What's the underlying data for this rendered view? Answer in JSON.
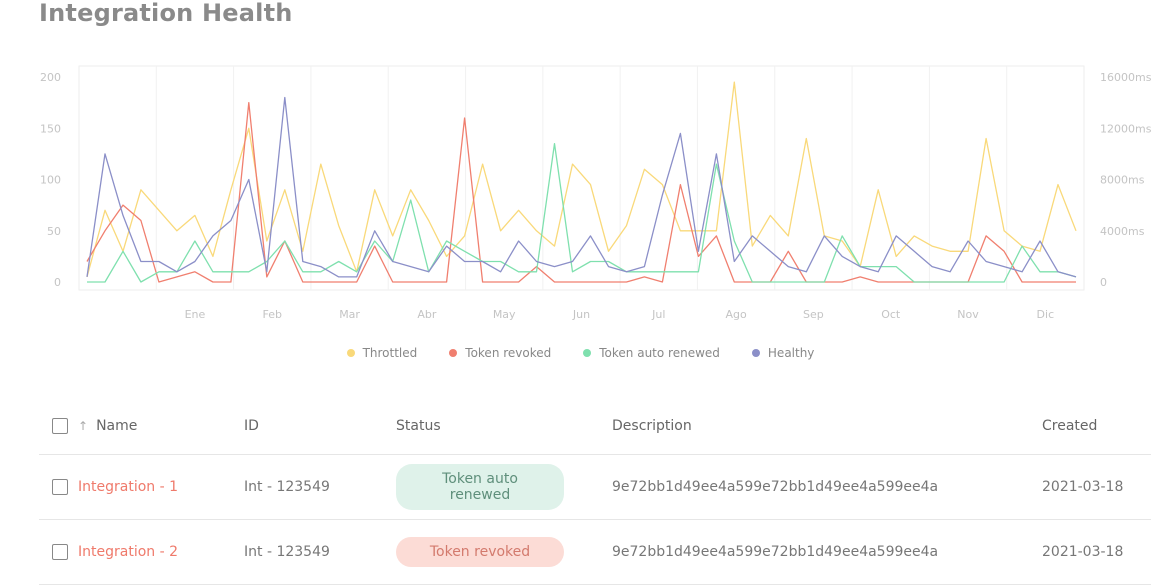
{
  "title": "Integration Health",
  "chart_data": {
    "type": "line",
    "categories": [
      "",
      "Ene",
      "Feb",
      "Mar",
      "Abr",
      "May",
      "Jun",
      "Jul",
      "Ago",
      "Sep",
      "Oct",
      "Nov",
      "Dic"
    ],
    "ylim_left": [
      0,
      200
    ],
    "yticks_left": [
      "0",
      "50",
      "100",
      "150",
      "200"
    ],
    "ylim_right": [
      0,
      16000
    ],
    "yticks_right": [
      "0",
      "4000ms",
      "8000ms",
      "12000ms",
      "16000ms"
    ],
    "grid": true,
    "legend_position": "bottom",
    "series": [
      {
        "name": "Throttled",
        "color": "#f9d97a",
        "values": [
          5,
          70,
          30,
          90,
          70,
          50,
          65,
          25,
          90,
          150,
          40,
          90,
          30,
          115,
          55,
          10,
          90,
          45,
          90,
          60,
          25,
          45,
          115,
          50,
          70,
          50,
          35,
          115,
          95,
          30,
          55,
          110,
          95,
          50,
          50,
          50,
          195,
          35,
          65,
          45,
          140,
          45,
          40,
          15,
          90,
          25,
          45,
          35,
          30,
          30,
          140,
          50,
          35,
          30,
          95,
          50
        ]
      },
      {
        "name": "Token revoked",
        "color": "#f07f6f",
        "values": [
          20,
          50,
          75,
          60,
          0,
          5,
          10,
          0,
          0,
          175,
          5,
          40,
          0,
          0,
          0,
          0,
          35,
          0,
          0,
          0,
          0,
          160,
          0,
          0,
          0,
          15,
          0,
          0,
          0,
          0,
          0,
          5,
          0,
          95,
          25,
          45,
          0,
          0,
          0,
          30,
          0,
          0,
          0,
          5,
          0,
          0,
          0,
          0,
          0,
          0,
          45,
          30,
          0,
          0,
          0,
          0
        ]
      },
      {
        "name": "Token auto renewed",
        "color": "#7fe0ae",
        "values": [
          0,
          0,
          30,
          0,
          10,
          10,
          40,
          10,
          10,
          10,
          20,
          40,
          10,
          10,
          20,
          10,
          40,
          20,
          80,
          10,
          40,
          30,
          20,
          20,
          10,
          10,
          135,
          10,
          20,
          20,
          10,
          10,
          10,
          10,
          10,
          115,
          40,
          0,
          0,
          0,
          0,
          0,
          45,
          15,
          15,
          15,
          0,
          0,
          0,
          0,
          0,
          0,
          35,
          10,
          10,
          5
        ]
      },
      {
        "name": "Healthy",
        "color": "#8b8fc8",
        "values": [
          5,
          125,
          65,
          20,
          20,
          10,
          20,
          45,
          60,
          100,
          10,
          180,
          20,
          15,
          5,
          5,
          50,
          20,
          15,
          10,
          35,
          20,
          20,
          10,
          40,
          20,
          15,
          20,
          45,
          15,
          10,
          15,
          85,
          145,
          30,
          125,
          20,
          45,
          30,
          15,
          10,
          45,
          25,
          15,
          10,
          45,
          30,
          15,
          10,
          40,
          20,
          15,
          10,
          40,
          10,
          5
        ]
      }
    ]
  },
  "table": {
    "headers": {
      "name": "Name",
      "id": "ID",
      "status": "Status",
      "description": "Description",
      "created": "Created"
    },
    "rows": [
      {
        "name": "Integration - 1",
        "id": "Int - 123549",
        "status": "Token auto renewed",
        "description": "9e72bb1d49ee4a599e72bb1d49ee4a599ee4a",
        "created": "2021-03-18"
      },
      {
        "name": "Integration - 2",
        "id": "Int - 123549",
        "status": "Token revoked",
        "description": "9e72bb1d49ee4a599e72bb1d49ee4a599ee4a",
        "created": "2021-03-18"
      }
    ]
  }
}
